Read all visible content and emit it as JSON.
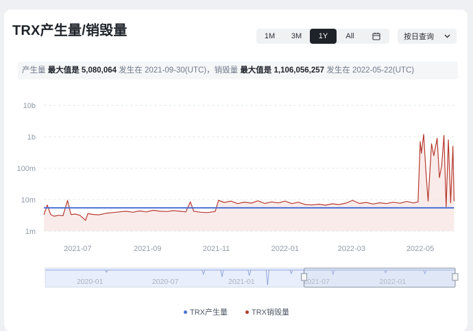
{
  "header": {
    "title": "TRX产生量/销毁量"
  },
  "range_buttons": [
    "1M",
    "3M",
    "1Y",
    "All"
  ],
  "active_range": "1Y",
  "query_select": {
    "label": "按日查询"
  },
  "summary": {
    "prod_label": "产生量",
    "prod_max_label": "最大值是",
    "prod_max_value": "5,080,064",
    "prod_at_label": "发生在",
    "prod_at_date": "2021-09-30(UTC)，",
    "burn_label": "销毁量",
    "burn_max_label": "最大值是",
    "burn_max_value": "1,106,056,257",
    "burn_at_label": "发生在",
    "burn_at_date": "2022-05-22(UTC)"
  },
  "colors": {
    "production": "#4a6fd6",
    "burn": "#b5392d",
    "burn_fill": "#f7e3e1",
    "grid": "#e6e8eb",
    "nav_fill": "#e8eefb",
    "nav_line": "#8fa6dc"
  },
  "chart_data": {
    "type": "line",
    "y_scale": "log",
    "ylim": [
      1000000,
      10000000000
    ],
    "y_ticks": [
      {
        "v": 1000000,
        "label": "1m"
      },
      {
        "v": 10000000,
        "label": "10m"
      },
      {
        "v": 100000000,
        "label": "100m"
      },
      {
        "v": 1000000000,
        "label": "1b"
      },
      {
        "v": 10000000000,
        "label": "10b"
      }
    ],
    "x_range": [
      "2021-06-01",
      "2022-06-01"
    ],
    "x_ticks": [
      "2021-07",
      "2021-09",
      "2021-11",
      "2022-01",
      "2022-03",
      "2022-05"
    ],
    "grid": true,
    "legend_position": "bottom",
    "series": [
      {
        "name": "TRX产生量",
        "color": "#4a6fd6",
        "points": [
          [
            "2021-06-01",
            5500000
          ],
          [
            "2021-10-31",
            5500000
          ],
          [
            "2021-11-01",
            5500000
          ],
          [
            "2022-05-31",
            5500000
          ]
        ]
      },
      {
        "name": "TRX销毁量",
        "color": "#b5392d",
        "points": [
          [
            "2021-06-01",
            3300000
          ],
          [
            "2021-06-04",
            6800000
          ],
          [
            "2021-06-07",
            3400000
          ],
          [
            "2021-06-10",
            3000000
          ],
          [
            "2021-06-14",
            3200000
          ],
          [
            "2021-06-18",
            3100000
          ],
          [
            "2021-06-22",
            9500000
          ],
          [
            "2021-06-25",
            3400000
          ],
          [
            "2021-06-29",
            3500000
          ],
          [
            "2021-07-03",
            3200000
          ],
          [
            "2021-07-08",
            2200000
          ],
          [
            "2021-07-10",
            3600000
          ],
          [
            "2021-07-15",
            3400000
          ],
          [
            "2021-07-20",
            3300000
          ],
          [
            "2021-07-26",
            3700000
          ],
          [
            "2021-08-01",
            3900000
          ],
          [
            "2021-08-07",
            4100000
          ],
          [
            "2021-08-13",
            4300000
          ],
          [
            "2021-08-19",
            4000000
          ],
          [
            "2021-08-25",
            4400000
          ],
          [
            "2021-08-31",
            4100000
          ],
          [
            "2021-09-06",
            4600000
          ],
          [
            "2021-09-12",
            4300000
          ],
          [
            "2021-09-18",
            4200000
          ],
          [
            "2021-09-24",
            4500000
          ],
          [
            "2021-09-30",
            4300000
          ],
          [
            "2021-10-05",
            4100000
          ],
          [
            "2021-10-09",
            8500000
          ],
          [
            "2021-10-12",
            4300000
          ],
          [
            "2021-10-18",
            4000000
          ],
          [
            "2021-10-24",
            3900000
          ],
          [
            "2021-10-31",
            4200000
          ],
          [
            "2021-11-03",
            9500000
          ],
          [
            "2021-11-08",
            8200000
          ],
          [
            "2021-11-14",
            9000000
          ],
          [
            "2021-11-20",
            7500000
          ],
          [
            "2021-11-26",
            8400000
          ],
          [
            "2021-12-02",
            7800000
          ],
          [
            "2021-12-08",
            9200000
          ],
          [
            "2021-12-14",
            7600000
          ],
          [
            "2021-12-20",
            8500000
          ],
          [
            "2021-12-26",
            7900000
          ],
          [
            "2022-01-01",
            9000000
          ],
          [
            "2022-01-07",
            7500000
          ],
          [
            "2022-01-13",
            8300000
          ],
          [
            "2022-01-19",
            7000000
          ],
          [
            "2022-01-25",
            6800000
          ],
          [
            "2022-01-31",
            7200000
          ],
          [
            "2022-02-06",
            6700000
          ],
          [
            "2022-02-12",
            7400000
          ],
          [
            "2022-02-18",
            7000000
          ],
          [
            "2022-02-24",
            7800000
          ],
          [
            "2022-03-02",
            9500000
          ],
          [
            "2022-03-08",
            7600000
          ],
          [
            "2022-03-14",
            8200000
          ],
          [
            "2022-03-20",
            7300000
          ],
          [
            "2022-03-26",
            8000000
          ],
          [
            "2022-04-01",
            7500000
          ],
          [
            "2022-04-07",
            8300000
          ],
          [
            "2022-04-13",
            7700000
          ],
          [
            "2022-04-19",
            8800000
          ],
          [
            "2022-04-25",
            7900000
          ],
          [
            "2022-04-29",
            8500000
          ],
          [
            "2022-05-01",
            700000000
          ],
          [
            "2022-05-02",
            300000000
          ],
          [
            "2022-05-04",
            1200000000
          ],
          [
            "2022-05-06",
            80000000
          ],
          [
            "2022-05-08",
            9000000
          ],
          [
            "2022-05-11",
            600000000
          ],
          [
            "2022-05-13",
            250000000
          ],
          [
            "2022-05-16",
            900000000
          ],
          [
            "2022-05-18",
            50000000
          ],
          [
            "2022-05-20",
            120000000
          ],
          [
            "2022-05-22",
            1106056257
          ],
          [
            "2022-05-24",
            6000000
          ],
          [
            "2022-05-26",
            800000000
          ],
          [
            "2022-05-28",
            8000000
          ],
          [
            "2022-05-30",
            500000000
          ],
          [
            "2022-05-31",
            9000000
          ]
        ]
      }
    ],
    "navigator": {
      "x_ticks": [
        "2020-01",
        "2020-07",
        "2021-01",
        "2021-07",
        "2022-01"
      ],
      "selection": [
        "2021-06-01",
        "2022-06-01"
      ]
    }
  }
}
